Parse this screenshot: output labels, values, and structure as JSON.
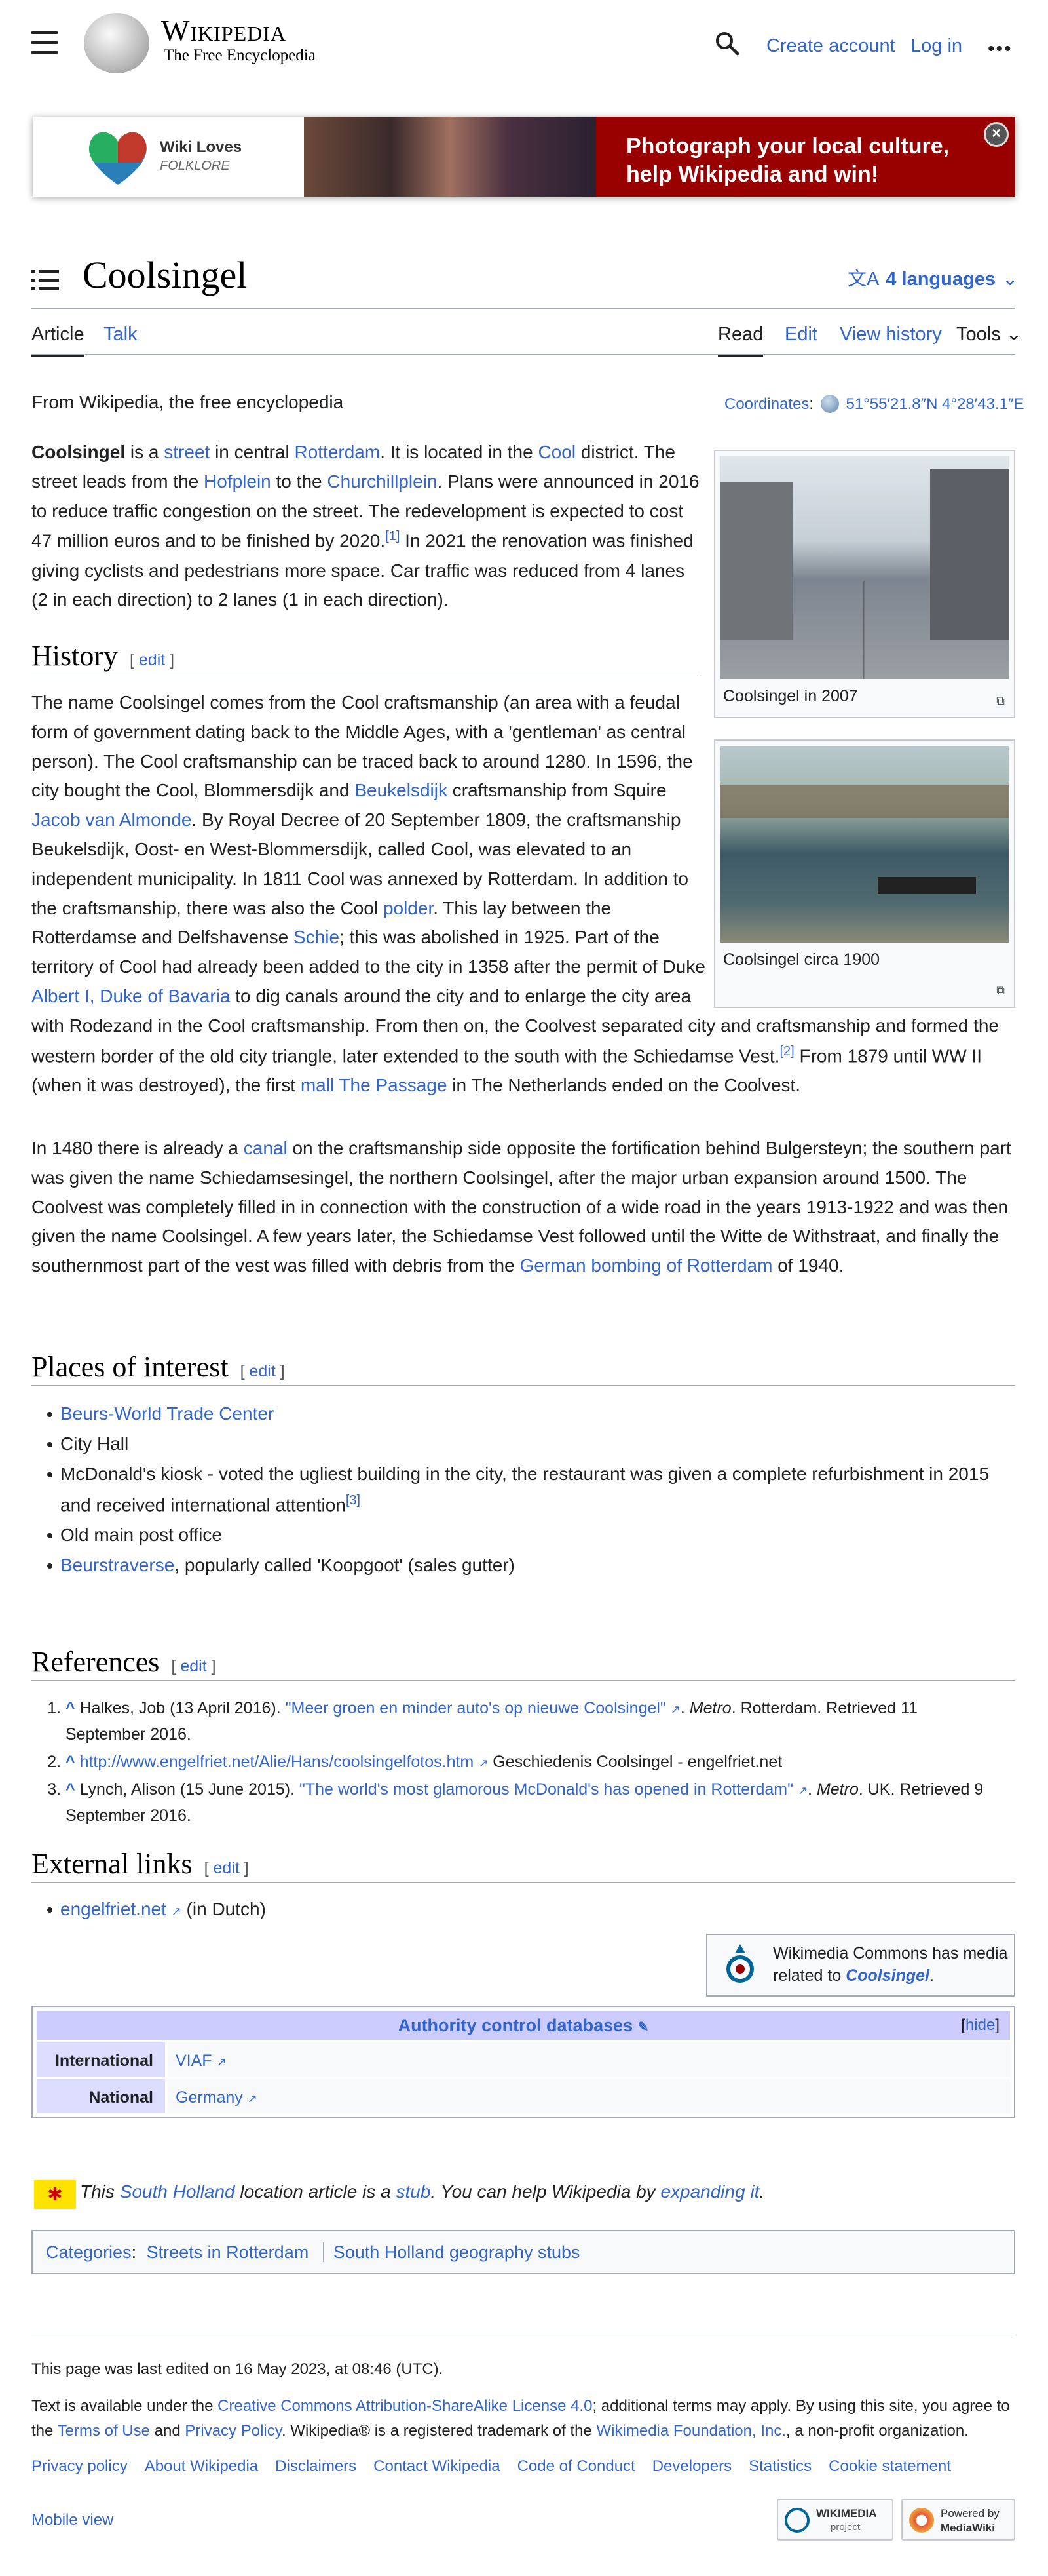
{
  "header": {
    "wordmark": "Wikipedia",
    "tagline": "The Free Encyclopedia",
    "create_account": "Create account",
    "log_in": "Log in",
    "more": "•••"
  },
  "banner": {
    "logo_line1": "Wiki Loves",
    "logo_line2": "FOLKLORE",
    "text": "Photograph your local culture, help Wikipedia and win!",
    "accent": "#990000"
  },
  "page": {
    "title": "Coolsingel",
    "languages": "4 languages",
    "tabs_left": [
      "Article",
      "Talk"
    ],
    "tabs_right": [
      "Read",
      "Edit",
      "View history",
      "Tools"
    ],
    "from": "From Wikipedia, the free encyclopedia",
    "coord_label": "Coordinates",
    "coord_value": "51°55′21.8″N 4°28′43.1″E"
  },
  "intro": {
    "s1": "Coolsingel",
    "s2": " is a ",
    "l1": "street",
    "s3": " in central ",
    "l2": "Rotterdam",
    "s4": ". It is located in the ",
    "l3": "Cool",
    "s5": " district. The street leads from the ",
    "l4": "Hofplein",
    "s6": " to the ",
    "l5": "Churchillplein",
    "s7": ". Plans were announced in 2016 to reduce traffic congestion on the street. The redevelopment is expected to cost 47 million euros and to be finished by 2020.",
    "ref": "[1]",
    "s8": " In 2021 the renovation was finished giving cyclists and pedestrians more space. Car traffic was reduced from 4 lanes (2 in each direction) to 2 lanes (1 in each direction)."
  },
  "figures": {
    "fig1_caption": "Coolsingel in 2007",
    "fig2_caption": "Coolsingel circa 1900"
  },
  "history": {
    "heading": "History",
    "edit": "edit",
    "p1a": "The name Coolsingel comes from the Cool craftsmanship (an area with a feudal form of government dating back to the Middle Ages, with a 'gentleman' as central person). The Cool craftsmanship can be traced back to around 1280. In 1596, the city bought the Cool, Blommersdijk and ",
    "p1l1": "Beukelsdijk",
    "p1b": " craftsmanship from Squire ",
    "p1l2": "Jacob van Almonde",
    "p1c": ". By Royal Decree of 20 September 1809, the craftsmanship Beukelsdijk, Oost- en West-Blommersdijk, called Cool, was elevated to an independent municipality. In 1811 Cool was annexed by Rotterdam. In addition to the craftsmanship, there was also the Cool ",
    "p1l3": "polder",
    "p1d": ". This lay between the Rotterdamse and Delfshavense ",
    "p1l4": "Schie",
    "p1e": "; this was abolished in 1925. Part of the territory of Cool had already been added to the city in 1358 after the permit of Duke ",
    "p1l5": "Albert I, Duke of Bavaria",
    "p1f": " to dig canals around the city and to enlarge the city area with Rodezand in the Cool craftsmanship. From then on, the Coolvest separated city and craftsmanship and formed the western border of the old city triangle, later extended to the south with the Schiedamse Vest.",
    "p1ref": "[2]",
    "p1g": " From 1879 until WW II (when it was destroyed), the first ",
    "p1l6": "mall",
    "p1h": " ",
    "p1l7": "The Passage",
    "p1i": " in The Netherlands ended on the Coolvest.",
    "p2a": "In 1480 there is already a ",
    "p2l1": "canal",
    "p2b": " on the craftsmanship side opposite the fortification behind Bulgersteyn; the southern part was given the name Schiedamsesingel, the northern Coolsingel, after the major urban expansion around 1500. The Coolvest was completely filled in in connection with the construction of a wide road in the years 1913-1922 and was then given the name Coolsingel. A few years later, the Schiedamse Vest followed until the Witte de Withstraat, and finally the southernmost part of the vest was filled with debris from the ",
    "p2l2": "German bombing of Rotterdam",
    "p2c": " of 1940."
  },
  "places": {
    "heading": "Places of interest",
    "edit": "edit",
    "i1": "Beurs-World Trade Center",
    "i2": "City Hall",
    "i3": "McDonald's kiosk - voted the ugliest building in the city, the restaurant was given a complete refurbishment in 2015 and received international attention",
    "i3ref": "[3]",
    "i4": "Old main post office",
    "i5l": "Beurstraverse",
    "i5": ", popularly called 'Koopgoot' (sales gutter)"
  },
  "references": {
    "heading": "References",
    "edit": "edit",
    "r1a": "Halkes, Job (13 April 2016). ",
    "r1l": "\"Meer groen en minder auto's op nieuwe Coolsingel\"",
    "r1b": ". ",
    "r1c": "Metro",
    "r1d": ". Rotterdam. Retrieved 11 September 2016.",
    "r2l": "http://www.engelfriet.net/Alie/Hans/coolsingelfotos.htm",
    "r2b": " Geschiedenis Coolsingel - engelfriet.net",
    "r3a": "Lynch, Alison (15 June 2015). ",
    "r3l": "\"The world's most glamorous McDonald's has opened in Rotterdam\"",
    "r3b": ". ",
    "r3c": "Metro",
    "r3d": ". UK. Retrieved 9 September 2016."
  },
  "external": {
    "heading": "External links",
    "edit": "edit",
    "l1": "engelfriet.net",
    "l1b": " (in Dutch)",
    "commons_a": "Wikimedia Commons has media related to ",
    "commons_b": "Coolsingel",
    "commons_c": "."
  },
  "authority": {
    "title": "Authority control databases",
    "hide": "hide",
    "row1_label": "International",
    "row1_value": "VIAF",
    "row2_label": "National",
    "row2_value": "Germany"
  },
  "stub": {
    "a": "This ",
    "l1": "South Holland",
    "b": " location article is a ",
    "l2": "stub",
    "c": ". You can help Wikipedia by ",
    "l3": "expanding it",
    "d": "."
  },
  "categories": {
    "label": "Categories",
    "c1": "Streets in Rotterdam",
    "c2": "South Holland geography stubs"
  },
  "footer": {
    "last_edited": "This page was last edited on 16 May 2023, at 08:46 (UTC).",
    "lic_a": "Text is available under the ",
    "lic_l1": "Creative Commons Attribution-ShareAlike License 4.0",
    "lic_b": "; additional terms may apply. By using this site, you agree to the ",
    "lic_l2": "Terms of Use",
    "lic_c": " and ",
    "lic_l3": "Privacy Policy",
    "lic_d": ". Wikipedia® is a registered trademark of the ",
    "lic_l4": "Wikimedia Foundation, Inc.",
    "lic_e": ", a non-profit organization.",
    "links": [
      "Privacy policy",
      "About Wikipedia",
      "Disclaimers",
      "Contact Wikipedia",
      "Code of Conduct",
      "Developers",
      "Statistics",
      "Cookie statement"
    ],
    "mobile_view": "Mobile view",
    "badge1_a": "WIKIMEDIA",
    "badge1_b": "project",
    "badge2_a": "Powered by",
    "badge2_b": "MediaWiki"
  }
}
